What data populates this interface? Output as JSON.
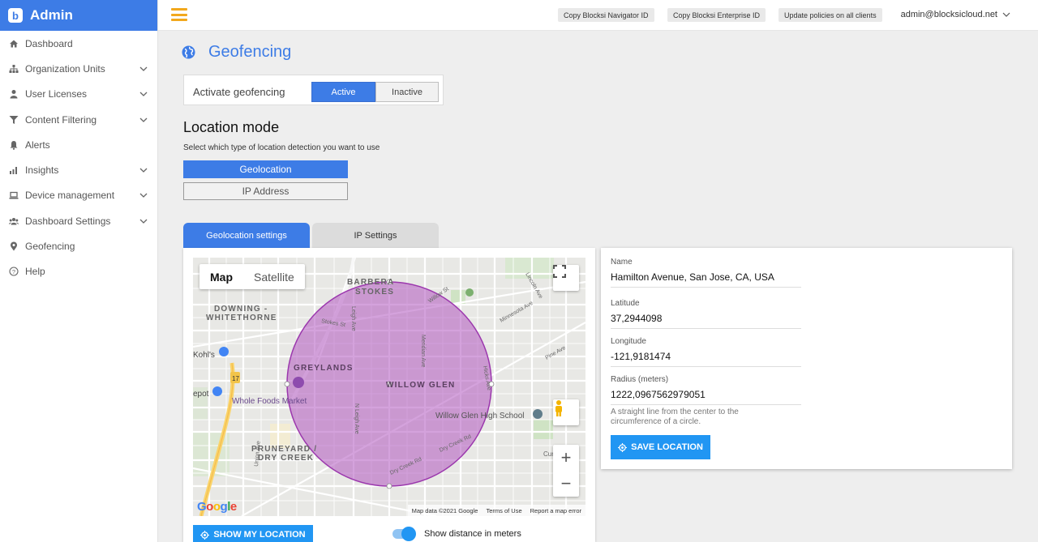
{
  "brand": {
    "logo_letter": "b",
    "title": "Admin"
  },
  "sidebar": {
    "items": [
      {
        "label": "Dashboard",
        "icon": "home-icon",
        "expandable": false
      },
      {
        "label": "Organization Units",
        "icon": "org-tree-icon",
        "expandable": true
      },
      {
        "label": "User Licenses",
        "icon": "person-icon",
        "expandable": true
      },
      {
        "label": "Content Filtering",
        "icon": "funnel-icon",
        "expandable": true
      },
      {
        "label": "Alerts",
        "icon": "bell-icon",
        "expandable": false
      },
      {
        "label": "Insights",
        "icon": "bar-chart-icon",
        "expandable": true
      },
      {
        "label": "Device management",
        "icon": "laptop-icon",
        "expandable": true
      },
      {
        "label": "Dashboard Settings",
        "icon": "users-icon",
        "expandable": true
      },
      {
        "label": "Geofencing",
        "icon": "map-pin-icon",
        "expandable": false
      },
      {
        "label": "Help",
        "icon": "help-icon",
        "expandable": false
      }
    ]
  },
  "topbar": {
    "buttons": [
      "Copy Blocksi Navigator ID",
      "Copy Blocksi Enterprise ID",
      "Update policies on all clients"
    ],
    "user": "admin@blocksicloud.net"
  },
  "page": {
    "title": "Geofencing",
    "activate": {
      "label": "Activate geofencing",
      "active_label": "Active",
      "inactive_label": "Inactive",
      "state": "Active"
    },
    "location_mode": {
      "title": "Location mode",
      "description": "Select which type of location detection you want to use",
      "options": [
        "Geolocation",
        "IP Address"
      ],
      "selected": "Geolocation"
    },
    "tabs": [
      "Geolocation settings",
      "IP Settings"
    ],
    "map": {
      "type_options": [
        "Map",
        "Satellite"
      ],
      "selected_type": "Map",
      "labels": {
        "barbera": "BARBERA",
        "stokes_area": "STOKES",
        "downing": "DOWNING -",
        "whitethorne": "WHITETHORNE",
        "greylands": "GREYLANDS",
        "willow_glen": "WILLOW GLEN",
        "pruneyard": "PRUNEYARD /",
        "dry_creek_area": "DRY CREEK",
        "kohls": "Kohl's",
        "depot": "epot",
        "whole_foods": "Whole Foods Market",
        "willow_glen_high": "Willow Glen High School",
        "minnesota": "Minnesota Ave",
        "lincoln": "Lincoln Ave",
        "pine": "Pine Ave",
        "hicks": "Hicks Ave",
        "meridian": "Meridian Ave",
        "n_leigh": "N Leigh Ave",
        "leigh": "Leigh Ave",
        "stokes_st": "Stokes St",
        "dry_creek_rd": "Dry Creek Rd",
        "dry_creek_rd2": "Dry Creek Rd",
        "union": "Union Ave",
        "willow_st": "Willow St",
        "hwy": "17",
        "curtner": "Curtner"
      },
      "footer": [
        "Map data ©2021 Google",
        "Terms of Use",
        "Report a map error"
      ],
      "logo": "Google"
    },
    "show_location_label": "SHOW MY LOCATION",
    "show_distance_label": "Show distance in meters",
    "show_distance_on": true
  },
  "location": {
    "name_label": "Name",
    "name": "Hamilton Avenue, San Jose, CA, USA",
    "lat_label": "Latitude",
    "lat": "37,2944098",
    "lng_label": "Longitude",
    "lng": "-121,9181474",
    "radius_label": "Radius (meters)",
    "radius": "1222,0967562979051",
    "hint": "A straight line from the center to the circumference of a circle.",
    "save_label": "SAVE LOCATION"
  },
  "colors": {
    "primary": "#3d7ce6",
    "button_blue": "#2196f3",
    "hamburger": "#f2a81d",
    "geofence": "#b156c0"
  }
}
